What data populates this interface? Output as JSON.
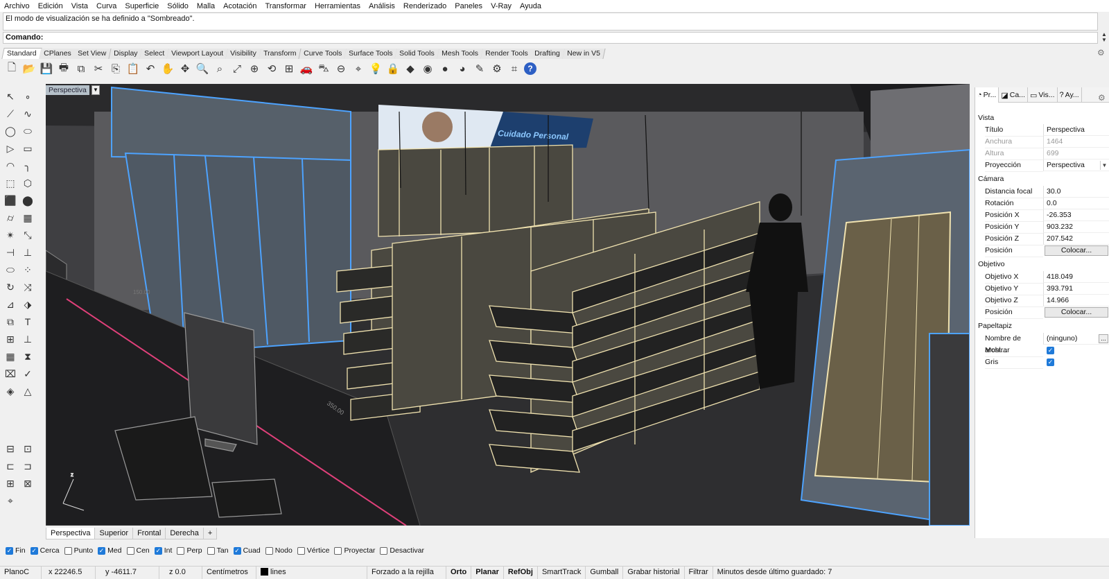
{
  "menu": [
    "Archivo",
    "Edición",
    "Vista",
    "Curva",
    "Superficie",
    "Sólido",
    "Malla",
    "Acotación",
    "Transformar",
    "Herramientas",
    "Análisis",
    "Renderizado",
    "Paneles",
    "V-Ray",
    "Ayuda"
  ],
  "command": {
    "history": "El modo de visualización se ha definido a \"Sombreado\".",
    "prompt": "Comando:"
  },
  "toolbar_tabs": [
    "Standard",
    "CPlanes",
    "Set View",
    "Display",
    "Select",
    "Viewport Layout",
    "Visibility",
    "Transform",
    "Curve Tools",
    "Surface Tools",
    "Solid Tools",
    "Mesh Tools",
    "Render Tools",
    "Drafting",
    "New in V5"
  ],
  "toolbar_icons": [
    "new-file-icon",
    "open-folder-icon",
    "save-icon",
    "print-icon",
    "import-icon",
    "cut-icon",
    "copy-icon",
    "paste-icon",
    "undo-icon",
    "pan-icon",
    "move-icon",
    "zoom-icon",
    "zoom-window-icon",
    "zoom-extents-icon",
    "zoom-selected-icon",
    "rotate-view-icon",
    "four-viewports-icon",
    "car-icon",
    "wireframe-car-icon",
    "plane-icon",
    "object-snap-icon",
    "bulb-icon",
    "lock-icon",
    "layers-icon",
    "color-wheel-icon",
    "sphere-icon",
    "render-sphere-icon",
    "paint-icon",
    "gear-settings-icon",
    "grid-snap-icon",
    "help-icon"
  ],
  "viewport": {
    "title": "Perspectiva",
    "tabs": [
      "Perspectiva",
      "Superior",
      "Frontal",
      "Derecha"
    ],
    "add_tab": "+",
    "sign_text": "Cuidado Personal",
    "dimension_label_1": "150.00",
    "dimension_label_2": "350.00"
  },
  "properties": {
    "tabs": [
      {
        "icon": "properties-icon",
        "label": "Pr..."
      },
      {
        "icon": "camera-icon",
        "label": "Ca..."
      },
      {
        "icon": "view-icon",
        "label": "Vis..."
      },
      {
        "icon": "help-panel-icon",
        "label": "Ay..."
      }
    ],
    "sections": {
      "vista": "Vista",
      "camara": "Cámara",
      "objetivo": "Objetivo",
      "papeltapiz": "Papeltapiz"
    },
    "rows": {
      "titulo": {
        "label": "Título",
        "value": "Perspectiva"
      },
      "anchura": {
        "label": "Anchura",
        "value": "1464"
      },
      "altura": {
        "label": "Altura",
        "value": "699"
      },
      "proyeccion": {
        "label": "Proyección",
        "value": "Perspectiva"
      },
      "distancia_focal": {
        "label": "Distancia focal",
        "value": "30.0"
      },
      "rotacion": {
        "label": "Rotación",
        "value": "0.0"
      },
      "pos_x": {
        "label": "Posición X",
        "value": "-26.353"
      },
      "pos_y": {
        "label": "Posición Y",
        "value": "903.232"
      },
      "pos_z": {
        "label": "Posición Z",
        "value": "207.542"
      },
      "posicion": {
        "label": "Posición",
        "button": "Colocar..."
      },
      "obj_x": {
        "label": "Objetivo X",
        "value": "418.049"
      },
      "obj_y": {
        "label": "Objetivo Y",
        "value": "393.791"
      },
      "obj_z": {
        "label": "Objetivo Z",
        "value": "14.966"
      },
      "obj_posicion": {
        "label": "Posición",
        "button": "Colocar..."
      },
      "nombre_archivo": {
        "label": "Nombre de archi...",
        "value": "(ninguno)",
        "button": "..."
      },
      "mostrar": {
        "label": "Mostrar",
        "checked": true
      },
      "gris": {
        "label": "Gris",
        "checked": true
      }
    }
  },
  "osnaps": [
    {
      "label": "Fin",
      "checked": true
    },
    {
      "label": "Cerca",
      "checked": true
    },
    {
      "label": "Punto",
      "checked": false
    },
    {
      "label": "Med",
      "checked": true
    },
    {
      "label": "Cen",
      "checked": false
    },
    {
      "label": "Int",
      "checked": true
    },
    {
      "label": "Perp",
      "checked": false
    },
    {
      "label": "Tan",
      "checked": false
    },
    {
      "label": "Cuad",
      "checked": true
    },
    {
      "label": "Nodo",
      "checked": false
    },
    {
      "label": "Vértice",
      "checked": false
    },
    {
      "label": "Proyectar",
      "checked": false
    },
    {
      "label": "Desactivar",
      "checked": false
    }
  ],
  "status": {
    "cplane": "PlanoC",
    "x": "x 22246.5",
    "y": "y -4611.7",
    "z": "z 0.0",
    "units": "Centímetros",
    "layer": "lines",
    "grid_snap": "Forzado a la rejilla",
    "ortho": "Orto",
    "planar": "Planar",
    "osnap": "RefObj",
    "smarttrack": "SmartTrack",
    "gumball": "Gumball",
    "history": "Grabar historial",
    "filter": "Filtrar",
    "autosave": "Minutos desde último guardado: 7"
  },
  "colors": {
    "viewport_bg": "#3f3f42",
    "selection_blue": "#4da3ff",
    "wire_cream": "#f1e3b0",
    "checkbox_blue": "#1f7ad9"
  }
}
